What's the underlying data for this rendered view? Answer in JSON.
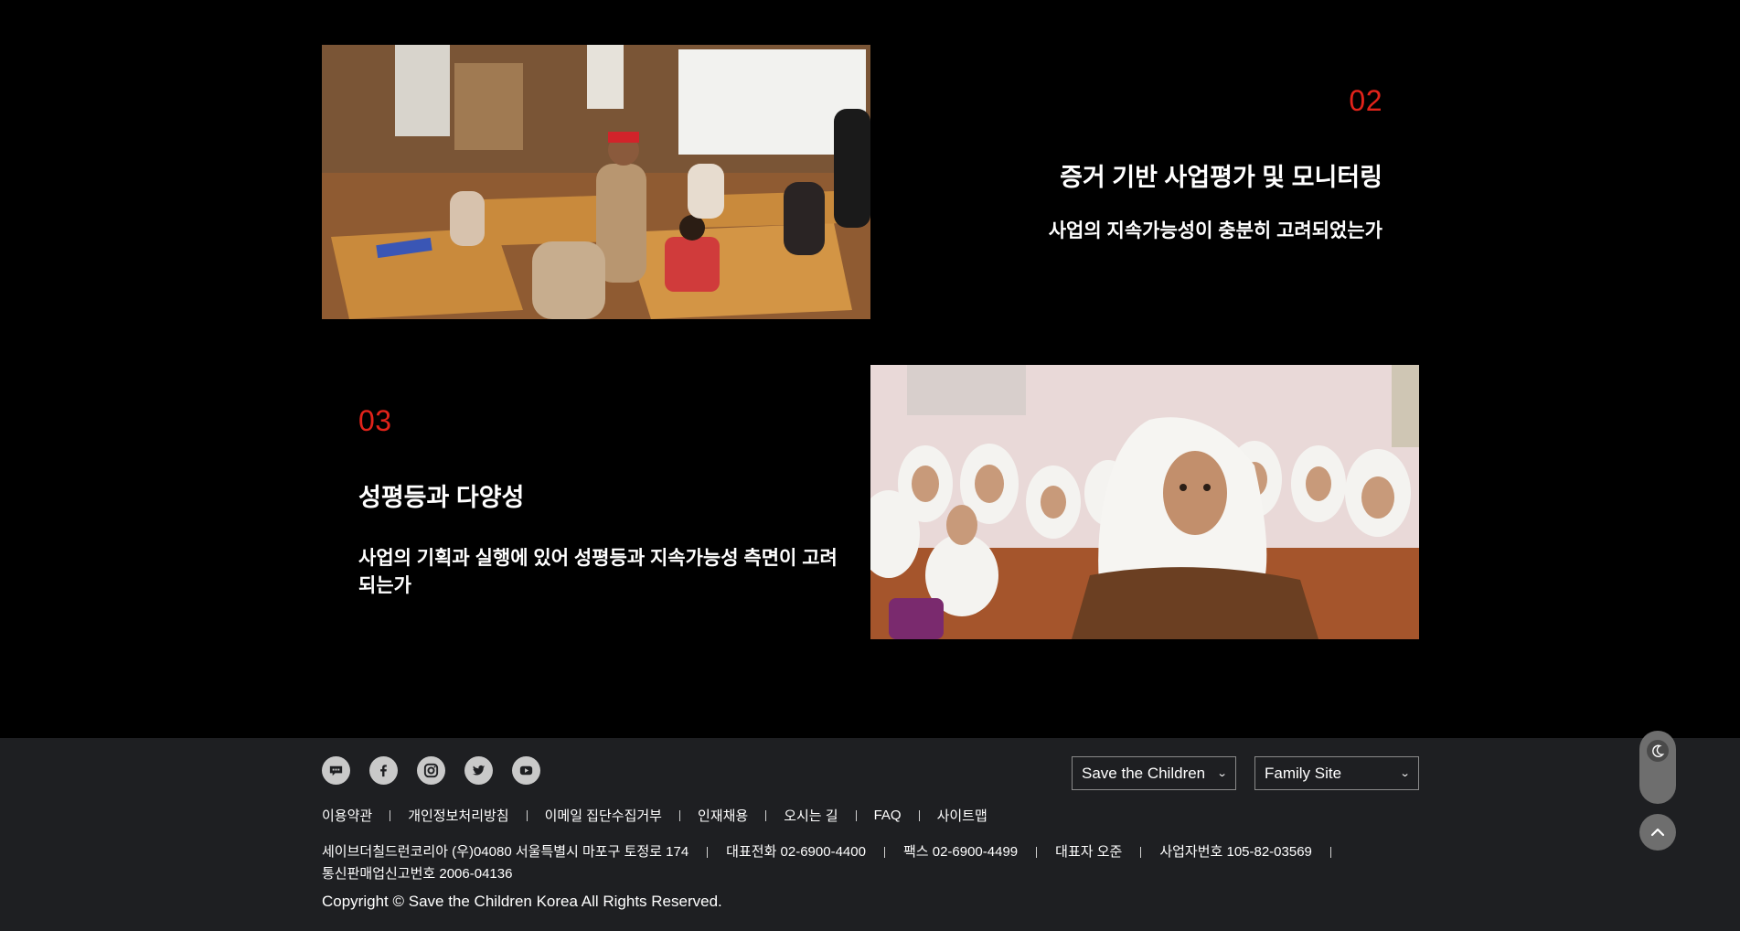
{
  "sections": [
    {
      "number": "02",
      "title": "증거 기반 사업평가 및 모니터링",
      "description": "사업의 지속가능성이 충분히 고려되었는가"
    },
    {
      "number": "03",
      "title": "성평등과 다양성",
      "description": "사업의 기획과 실행에 있어 성평등과 지속가능성 측면이 고려되는가"
    }
  ],
  "footer": {
    "social": [
      {
        "icon": "kakao-talk-icon"
      },
      {
        "icon": "facebook-icon"
      },
      {
        "icon": "instagram-icon"
      },
      {
        "icon": "twitter-icon"
      },
      {
        "icon": "youtube-icon"
      }
    ],
    "selects": {
      "save_the_children": "Save the Children",
      "family_site": "Family Site"
    },
    "links": [
      "이용약관",
      "개인정보처리방침",
      "이메일 집단수집거부",
      "인재채용",
      "오시는 길",
      "FAQ",
      "사이트맵"
    ],
    "info": {
      "org": "세이브더칠드런코리아 (우)04080 서울특별시 마포구 토정로 174",
      "phone": "대표전화 02-6900-4400",
      "fax": "팩스 02-6900-4499",
      "ceo": "대표자 오준",
      "biz_no": "사업자번호 105-82-03569",
      "mail_order": "통신판매업신고번호 2006-04136"
    },
    "copyright": "Copyright © Save the Children Korea All Rights Reserved."
  },
  "colors": {
    "accent": "#e2231a",
    "background": "#000000",
    "footer_bg": "#1e1f22"
  }
}
